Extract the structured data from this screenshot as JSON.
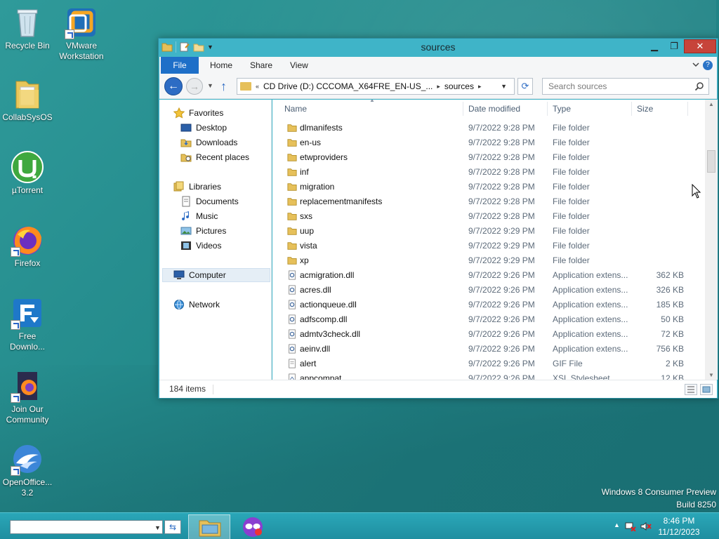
{
  "desktop": {
    "icons": [
      {
        "label": "Recycle Bin"
      },
      {
        "label": "VMware Workstation"
      },
      {
        "label": "CollabSysOS"
      },
      {
        "label": "µTorrent"
      },
      {
        "label": "Firefox"
      },
      {
        "label": "Free Downlo..."
      },
      {
        "label": "Join Our Community"
      },
      {
        "label": "OpenOffice... 3.2"
      }
    ],
    "watermark_line1": "Windows 8 Consumer Preview",
    "watermark_line2": "Build 8250"
  },
  "window": {
    "title": "sources",
    "tabs": {
      "file": "File",
      "home": "Home",
      "share": "Share",
      "view": "View"
    },
    "help": "?",
    "address": {
      "segments": [
        "CD Drive (D:) CCCOMA_X64FRE_EN-US_...",
        "sources"
      ]
    },
    "search_placeholder": "Search sources",
    "nav": {
      "favorites": "Favorites",
      "desktop": "Desktop",
      "downloads": "Downloads",
      "recent": "Recent places",
      "libraries": "Libraries",
      "documents": "Documents",
      "music": "Music",
      "pictures": "Pictures",
      "videos": "Videos",
      "computer": "Computer",
      "network": "Network"
    },
    "columns": {
      "name": "Name",
      "date": "Date modified",
      "type": "Type",
      "size": "Size"
    },
    "files": [
      {
        "name": "dlmanifests",
        "date": "9/7/2022 9:28 PM",
        "type": "File folder",
        "size": "",
        "kind": "folder"
      },
      {
        "name": "en-us",
        "date": "9/7/2022 9:28 PM",
        "type": "File folder",
        "size": "",
        "kind": "folder"
      },
      {
        "name": "etwproviders",
        "date": "9/7/2022 9:28 PM",
        "type": "File folder",
        "size": "",
        "kind": "folder"
      },
      {
        "name": "inf",
        "date": "9/7/2022 9:28 PM",
        "type": "File folder",
        "size": "",
        "kind": "folder"
      },
      {
        "name": "migration",
        "date": "9/7/2022 9:28 PM",
        "type": "File folder",
        "size": "",
        "kind": "folder"
      },
      {
        "name": "replacementmanifests",
        "date": "9/7/2022 9:28 PM",
        "type": "File folder",
        "size": "",
        "kind": "folder"
      },
      {
        "name": "sxs",
        "date": "9/7/2022 9:28 PM",
        "type": "File folder",
        "size": "",
        "kind": "folder"
      },
      {
        "name": "uup",
        "date": "9/7/2022 9:29 PM",
        "type": "File folder",
        "size": "",
        "kind": "folder"
      },
      {
        "name": "vista",
        "date": "9/7/2022 9:29 PM",
        "type": "File folder",
        "size": "",
        "kind": "folder"
      },
      {
        "name": "xp",
        "date": "9/7/2022 9:29 PM",
        "type": "File folder",
        "size": "",
        "kind": "folder"
      },
      {
        "name": "acmigration.dll",
        "date": "9/7/2022 9:26 PM",
        "type": "Application extens...",
        "size": "362 KB",
        "kind": "dll"
      },
      {
        "name": "acres.dll",
        "date": "9/7/2022 9:26 PM",
        "type": "Application extens...",
        "size": "326 KB",
        "kind": "dll"
      },
      {
        "name": "actionqueue.dll",
        "date": "9/7/2022 9:26 PM",
        "type": "Application extens...",
        "size": "185 KB",
        "kind": "dll"
      },
      {
        "name": "adfscomp.dll",
        "date": "9/7/2022 9:26 PM",
        "type": "Application extens...",
        "size": "50 KB",
        "kind": "dll"
      },
      {
        "name": "admtv3check.dll",
        "date": "9/7/2022 9:26 PM",
        "type": "Application extens...",
        "size": "72 KB",
        "kind": "dll"
      },
      {
        "name": "aeinv.dll",
        "date": "9/7/2022 9:26 PM",
        "type": "Application extens...",
        "size": "756 KB",
        "kind": "dll"
      },
      {
        "name": "alert",
        "date": "9/7/2022 9:26 PM",
        "type": "GIF File",
        "size": "2 KB",
        "kind": "gif"
      },
      {
        "name": "appcompat",
        "date": "9/7/2022 9:26 PM",
        "type": "XSL Stylesheet",
        "size": "12 KB",
        "kind": "xsl"
      }
    ],
    "status_count": "184 items"
  },
  "taskbar": {
    "address_value": "",
    "time": "8:46 PM",
    "date": "11/12/2023"
  },
  "colors": {
    "accent": "#1e6fc8",
    "window_frame": "#3fb4c8",
    "taskbar": "#2aa7b8",
    "close_button": "#c7443a"
  }
}
